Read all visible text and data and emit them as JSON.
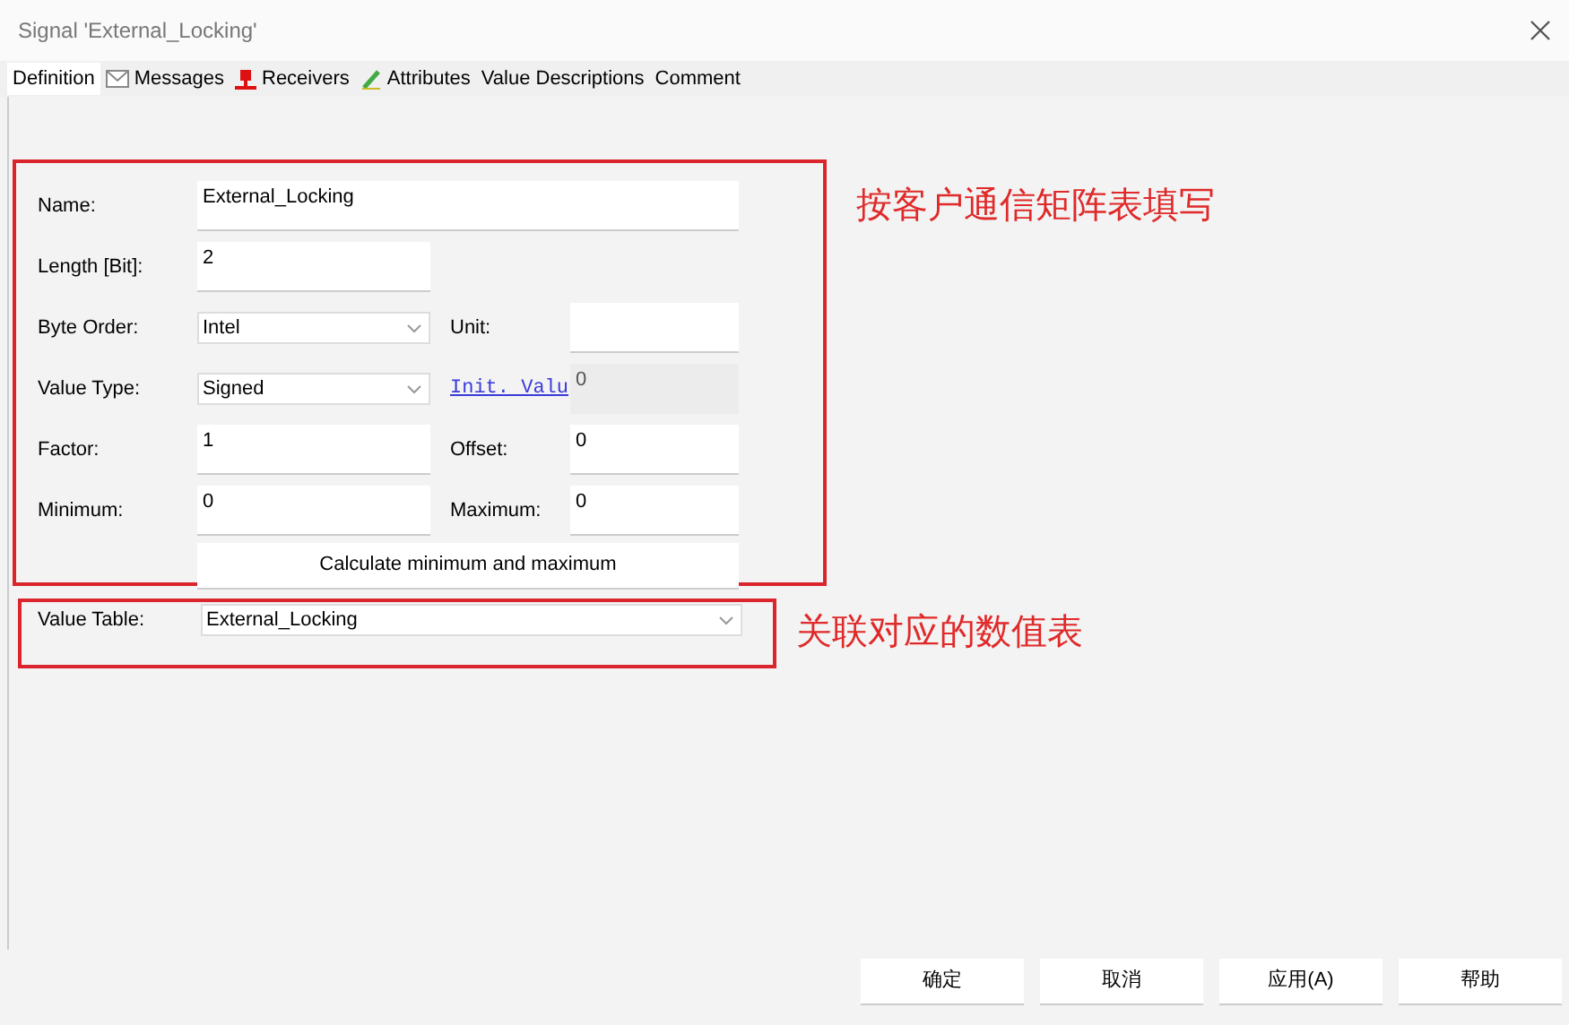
{
  "window": {
    "title": "Signal 'External_Locking'"
  },
  "tabs": [
    {
      "label": "Definition",
      "selected": true,
      "kind": "plain"
    },
    {
      "label": "Messages",
      "selected": false,
      "kind": "envelope"
    },
    {
      "label": "Receivers",
      "selected": false,
      "kind": "pin"
    },
    {
      "label": "Attributes",
      "selected": false,
      "kind": "pencil"
    },
    {
      "label": "Value Descriptions",
      "selected": false,
      "kind": "plain"
    },
    {
      "label": "Comment",
      "selected": false,
      "kind": "plain"
    }
  ],
  "form": {
    "name": {
      "label": "Name:",
      "value": "External_Locking"
    },
    "length": {
      "label": "Length [Bit]:",
      "value": "2"
    },
    "byte_order": {
      "label": "Byte Order:",
      "value": "Intel"
    },
    "unit": {
      "label": "Unit:"
    },
    "value_type": {
      "label": "Value Type:",
      "value": "Signed"
    },
    "init_value": {
      "label": "Init. Valu",
      "value": "0",
      "disabled": true
    },
    "factor": {
      "label": "Factor:",
      "value": "1"
    },
    "offset": {
      "label": "Offset:",
      "value": "0"
    },
    "minimum": {
      "label": "Minimum:",
      "value": "0"
    },
    "maximum": {
      "label": "Maximum:",
      "value": "0"
    },
    "calculate_button": "Calculate minimum and maximum"
  },
  "value_table": {
    "label": "Value Table:",
    "value": "External_Locking"
  },
  "annotations": [
    "按客户通信矩阵表填写",
    "关联对应的数值表"
  ],
  "buttons": [
    "确定",
    "取消",
    "应用(A)",
    "帮助"
  ]
}
